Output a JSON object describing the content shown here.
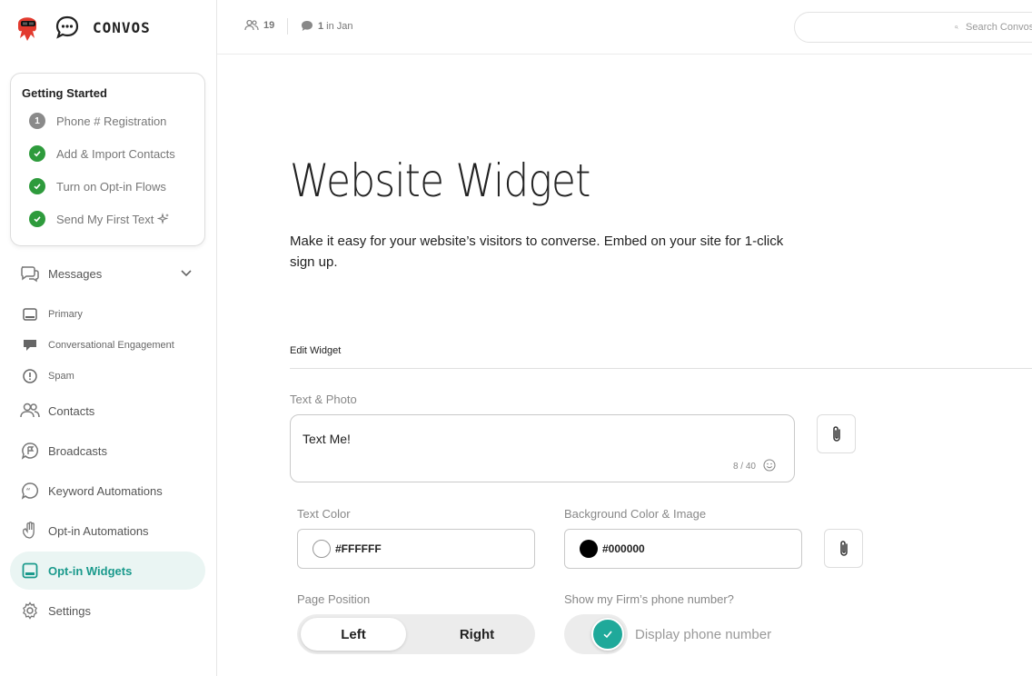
{
  "app": {
    "name": "CONVOS"
  },
  "getting_started": {
    "title": "Getting Started",
    "items": [
      {
        "label": "Phone # Registration",
        "status": "pending",
        "badge": "1"
      },
      {
        "label": "Add & Import Contacts",
        "status": "done"
      },
      {
        "label": "Turn on Opt-in Flows",
        "status": "done"
      },
      {
        "label": "Send My First Text",
        "status": "done"
      }
    ]
  },
  "nav": {
    "messages": "Messages",
    "primary": "Primary",
    "conversational": "Conversational Engagement",
    "spam": "Spam",
    "contacts": "Contacts",
    "broadcasts": "Broadcasts",
    "keyword": "Keyword Automations",
    "optin_automations": "Opt-in Automations",
    "optin_widgets": "Opt-in Widgets",
    "settings": "Settings"
  },
  "topbar": {
    "contacts_count": "19",
    "messages_count": "1",
    "messages_suffix": "in Jan",
    "search_placeholder": "Search Convos"
  },
  "main": {
    "title": "Website Widget",
    "description": "Make it easy for your website’s visitors to converse. Embed on your site for 1-click sign up.",
    "tab": "Edit Widget",
    "text_photo_label": "Text & Photo",
    "text_value": "Text Me!",
    "char_count": "8 / 40",
    "text_color_label": "Text Color",
    "text_color_value": "#FFFFFF",
    "bg_color_label": "Background Color & Image",
    "bg_color_value": "#000000",
    "page_position_label": "Page Position",
    "position_left": "Left",
    "position_right": "Right",
    "phone_label": "Show my Firm’s phone number?",
    "phone_toggle_label": "Display phone number"
  },
  "colors": {
    "accent": "#1fa99a",
    "done": "#2e9b3c",
    "pending": "#8a8a8a"
  }
}
